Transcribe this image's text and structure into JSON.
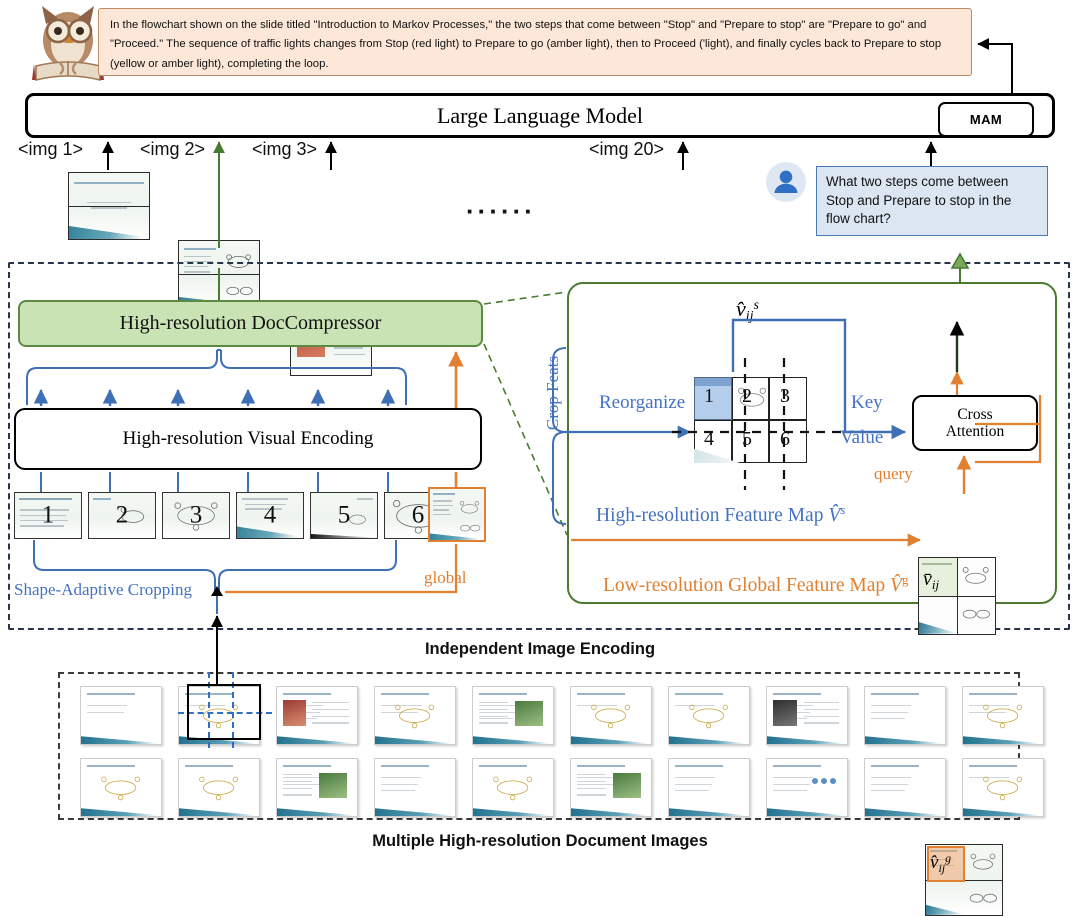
{
  "response": {
    "text": "In the flowchart shown on the slide titled \"Introduction to Markov Processes,\" the two steps that come between \"Stop\" and \"Prepare to stop\" are \"Prepare to go\" and \"Proceed.\" The sequence of traffic lights changes from Stop (red light) to Prepare to go (amber light), then to Proceed ('light), and finally cycles back to Prepare to stop (yellow or amber light), completing the loop."
  },
  "model": {
    "title": "Large Language Model",
    "badge": "MAM"
  },
  "image_tokens": [
    {
      "label": "<img 1>"
    },
    {
      "label": "<img 2>"
    },
    {
      "label": "<img 3>"
    },
    {
      "label": "<img 20>"
    }
  ],
  "ellipsis": "······",
  "query": {
    "text": "What two steps come between Stop and Prepare to stop in the flow chart?",
    "avatar_icon": "user-avatar-icon"
  },
  "pipeline": {
    "doccompressor": "High-resolution DocCompressor",
    "visual_encoding": "High-resolution Visual Encoding",
    "cropping_label": "Shape-Adaptive Cropping",
    "global_label": "global",
    "crops": [
      "1",
      "2",
      "3",
      "4",
      "5",
      "6"
    ],
    "encoding_caption": "Independent Image Encoding"
  },
  "detail": {
    "crop_feats": "Crop Feats",
    "reorganize": "Reorganize",
    "key": "Key",
    "value": "Value",
    "query_label": "query",
    "cross_attention_line1": "Cross",
    "cross_attention_line2": "Attention",
    "feature_map_label": "High-resolution Feature Map",
    "feature_map_symbol": "V̂",
    "feature_map_sup": "s",
    "global_map_label": "Low-resolution Global Feature Map",
    "global_map_symbol": "V̂",
    "global_map_sup": "g",
    "v_hat_s": "v̂",
    "v_hat_s_sub": "ij",
    "v_hat_s_sup": "s",
    "v_bar": "v̄",
    "v_bar_sub": "ij",
    "v_hat_g": "v̂",
    "v_hat_g_sub": "ij",
    "v_hat_g_sup": "g",
    "grid_numbers": [
      "1",
      "2",
      "3",
      "4",
      "5",
      "6"
    ]
  },
  "documents": {
    "caption": "Multiple High-resolution Document Images",
    "row1_count": 10,
    "row2_count": 10,
    "selected_index": 2
  },
  "colors": {
    "green_fill": "#c9e3b4",
    "green_border": "#5c8a43",
    "blue": "#4472c4",
    "orange": "#e08030",
    "peach_fill": "#fce7d8",
    "query_fill": "#dce6f2",
    "dashed_navy": "#27344a"
  }
}
